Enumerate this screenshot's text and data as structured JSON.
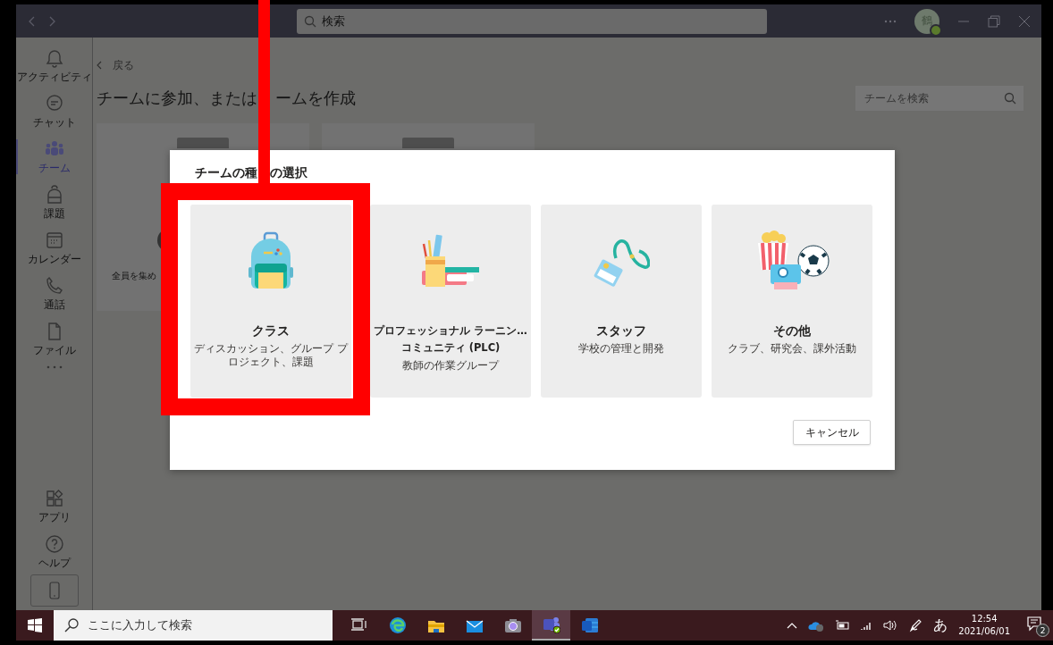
{
  "title_bar": {
    "search": {
      "placeholder": "検索"
    },
    "avatar": {
      "initial": "鶴"
    }
  },
  "sidebar": {
    "items": [
      {
        "kind": "bell",
        "label": "アクティビティ",
        "selected": false
      },
      {
        "kind": "chat",
        "label": "チャット",
        "selected": false
      },
      {
        "kind": "teams",
        "label": "チーム",
        "selected": true
      },
      {
        "kind": "backpack",
        "label": "課題",
        "selected": false
      },
      {
        "kind": "calendar",
        "label": "カレンダー",
        "selected": false
      },
      {
        "kind": "phone",
        "label": "通話",
        "selected": false
      },
      {
        "kind": "file",
        "label": "ファイル",
        "selected": false
      }
    ],
    "bottom_items": [
      {
        "kind": "apps",
        "label": "アプリ"
      },
      {
        "kind": "help",
        "label": "ヘルプ"
      }
    ]
  },
  "main": {
    "back_link": "戻る",
    "heading_parts": [
      "チームに参加、または",
      "ームを作成"
    ],
    "team_search": {
      "placeholder": "チームを検索"
    },
    "background_card_text": "全員を集め"
  },
  "dialog": {
    "title_parts": [
      "チームの種",
      "の選択"
    ],
    "team_types": [
      {
        "kind": "class",
        "title_lines": [
          "クラス"
        ],
        "description": "ディスカッション、グループ プロジェクト、課題"
      },
      {
        "kind": "plc",
        "title_lines": [
          "プロフェッショナル ラーニン…",
          "コミュニティ (PLC)"
        ],
        "description": "教師の作業グループ"
      },
      {
        "kind": "staff",
        "title_lines": [
          "スタッフ"
        ],
        "description": "学校の管理と開発"
      },
      {
        "kind": "other",
        "title_lines": [
          "その他"
        ],
        "description": "クラブ、研究会、課外活動"
      }
    ],
    "cancel_button": "キャンセル"
  },
  "taskbar": {
    "search": {
      "placeholder": "ここに入力して検索"
    },
    "apps": [
      {
        "kind": "taskview",
        "active": false
      },
      {
        "kind": "edge",
        "active": false
      },
      {
        "kind": "explorer",
        "active": false
      },
      {
        "kind": "mail",
        "active": false
      },
      {
        "kind": "camera",
        "active": false
      },
      {
        "kind": "teams",
        "active": true
      },
      {
        "kind": "word",
        "active": false
      }
    ],
    "ime": "あ",
    "time": "12:54",
    "date": "2021/06/01",
    "notification_count": "2"
  }
}
